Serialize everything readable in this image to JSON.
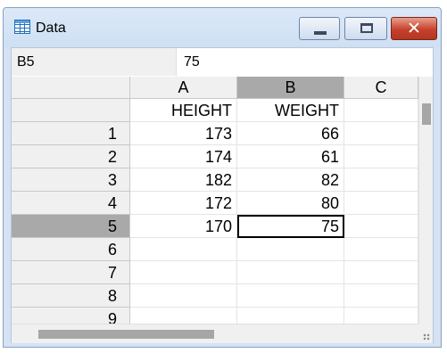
{
  "window": {
    "title": "Data",
    "icon": "table-icon",
    "close_glyph": "✕"
  },
  "formula_bar": {
    "cell_ref": "B5",
    "value": "75"
  },
  "columns": [
    "A",
    "B",
    "C"
  ],
  "selected_column": "B",
  "rows": [
    "1",
    "2",
    "3",
    "4",
    "5",
    "6",
    "7",
    "8",
    "9"
  ],
  "selected_row": "5",
  "header_row": {
    "A": "HEIGHT",
    "B": "WEIGHT"
  },
  "data": [
    {
      "A": "173",
      "B": "66"
    },
    {
      "A": "174",
      "B": "61"
    },
    {
      "A": "182",
      "B": "82"
    },
    {
      "A": "172",
      "B": "80"
    },
    {
      "A": "170",
      "B": "75"
    }
  ],
  "colors": {
    "selection_header": "#a9a9a9",
    "close_button": "#c6412c"
  }
}
